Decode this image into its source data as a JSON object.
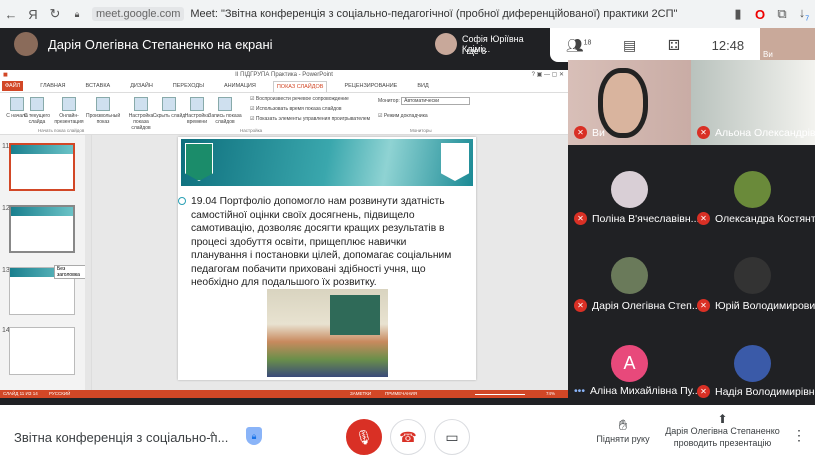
{
  "browser": {
    "url": "meet.google.com",
    "title": "Meet: \"Звітна конференція з соціально-педагогічної (пробної диференційованої) практики 2СП\"",
    "download_badge": "7"
  },
  "meet_header": {
    "presenter_label": "Дарія Олегівна Степаненко на екрані",
    "others_name": "Софія Юріївна Клімі...",
    "others_more": "і ще 8",
    "participants_count": "18",
    "time": "12:48",
    "self_label": "Ви"
  },
  "powerpoint": {
    "title": "ІІ ПІДГРУПА Практика - PowerPoint",
    "tabs": [
      "ФАЙЛ",
      "ГЛАВНАЯ",
      "ВСТАВКА",
      "ДИЗАЙН",
      "ПЕРЕХОДЫ",
      "АНИМАЦИЯ",
      "ПОКАЗ СЛАЙДОВ",
      "РЕЦЕНЗИРОВАНИЕ",
      "ВИД"
    ],
    "ribbon": {
      "buttons": [
        "С начала",
        "С текущего слайда",
        "Онлайн-презентация",
        "Произвольный показ",
        "Настройка показа слайдов",
        "Скрыть слайд",
        "Настройка времени",
        "Запись показа слайдов"
      ],
      "checks": [
        "Воспроизвести речевое сопровождение",
        "Использовать время показа слайдов",
        "Показать элементы управления проигрывателем"
      ],
      "monitor_label": "Монитор:",
      "monitor_value": "Автоматически",
      "presenter_view": "Режим докладчика",
      "groups": [
        "Начать показ слайдов",
        "Настройка",
        "Мониторы"
      ]
    },
    "thumbnails": [
      "11",
      "12",
      "13",
      "14"
    ],
    "tooltip": "Без заголовка",
    "slide_text": "19.04 Портфоліо допомогло нам розвинути здатність самостійної оцінки своїх досягнень, підвищело самотивацію, дозволяє досягти кращих результатів в процесі здобуття освіти, прищеплює навички планування і постановки цілей, допомагає соціальним педагогам  побачити приховані здібності учня, що необхідно для подальшого їх розвитку.",
    "status_left": "СЛАЙД 11 ИЗ 14",
    "language": "РУССКИЙ",
    "notes": "ЗАМЕТКИ",
    "comments": "ПРИМЕЧАНИЯ",
    "zoom": "74%"
  },
  "participants": [
    {
      "name": "Ви",
      "muted": true
    },
    {
      "name": "Альона Олександрів...",
      "muted": true
    },
    {
      "name": "Поліна В'ячеславівн...",
      "muted": true,
      "color": "#d9cfd6"
    },
    {
      "name": "Олександра Костянт...",
      "muted": true,
      "color": "#6a8a3a"
    },
    {
      "name": "Дарія Олегівна Степ...",
      "muted": true,
      "color": "#6a7a5a"
    },
    {
      "name": "Юрій Володимирови...",
      "muted": true,
      "color": "#333333"
    },
    {
      "name": "Аліна Михайлівна Пу...",
      "muted": false,
      "initial": "А",
      "color": "#e8497b"
    },
    {
      "name": "Надія Володимирівн...",
      "muted": true,
      "color": "#3a5aa8"
    }
  ],
  "bottom": {
    "meeting_title": "Звітна конференція з соціально-п...",
    "raise_hand": "Підняти руку",
    "presenting_line1": "Дарія Олегівна Степаненко",
    "presenting_line2": "проводить презентацію"
  },
  "colors": {
    "accent_red": "#d93025",
    "ppt_orange": "#d24726"
  }
}
